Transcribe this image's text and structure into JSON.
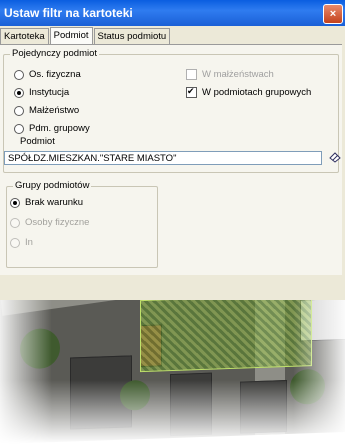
{
  "window": {
    "title": "Ustaw filtr na kartoteki",
    "close_label": "×"
  },
  "tabs": [
    {
      "label": "Kartoteka",
      "active": false
    },
    {
      "label": "Podmiot",
      "active": true
    },
    {
      "label": "Status podmiotu",
      "active": false
    }
  ],
  "single_subject": {
    "group_label": "Pojedynczy podmiot",
    "options": [
      {
        "label": "Os. fizyczna",
        "selected": false
      },
      {
        "label": "Instytucja",
        "selected": true
      },
      {
        "label": "Małżeństwo",
        "selected": false
      },
      {
        "label": "Pdm. grupowy",
        "selected": false
      }
    ],
    "checkboxes": [
      {
        "label": "W małżeństwach",
        "checked": false,
        "enabled": false
      },
      {
        "label": "W podmiotach grupowych",
        "checked": true,
        "enabled": true
      }
    ],
    "subject_label": "Podmiot",
    "subject_value": "SPÓŁDZ.MIESZKAN.\"STARE MIASTO\""
  },
  "subject_groups": {
    "group_label": "Grupy podmiotów",
    "options": [
      {
        "label": "Brak warunku",
        "selected": true
      },
      {
        "label": "Osoby fizyczne",
        "selected": false
      },
      {
        "label": "In",
        "selected": false
      }
    ]
  },
  "icons": {
    "clear": "eraser-icon"
  },
  "colors": {
    "titlebar": "#2f7cf0",
    "hatch": "#a0c850"
  }
}
